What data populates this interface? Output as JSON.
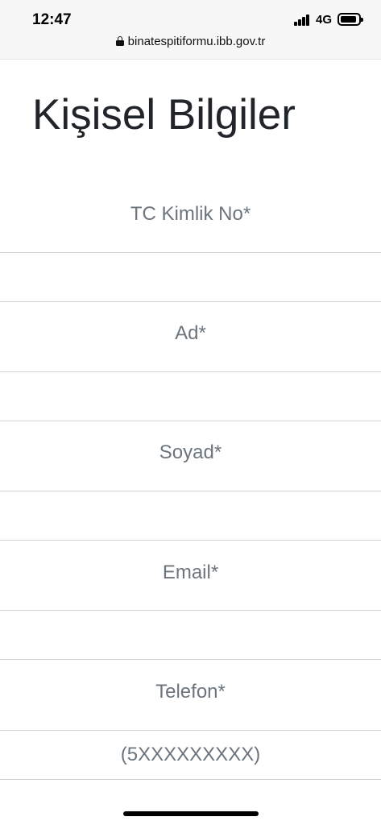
{
  "status_bar": {
    "time": "12:47",
    "network": "4G",
    "url": "binatespitiformu.ibb.gov.tr"
  },
  "page": {
    "title": "Kişisel Bilgiler"
  },
  "form": {
    "fields": [
      {
        "label": "TC Kimlik No*",
        "value": "",
        "placeholder": ""
      },
      {
        "label": "Ad*",
        "value": "",
        "placeholder": ""
      },
      {
        "label": "Soyad*",
        "value": "",
        "placeholder": ""
      },
      {
        "label": "Email*",
        "value": "",
        "placeholder": ""
      },
      {
        "label": "Telefon*",
        "value": "",
        "placeholder": "(5XXXXXXXXX)"
      }
    ]
  },
  "colors": {
    "label_text": "#6c757d",
    "title_text": "#212529",
    "input_border": "#ced4da"
  }
}
